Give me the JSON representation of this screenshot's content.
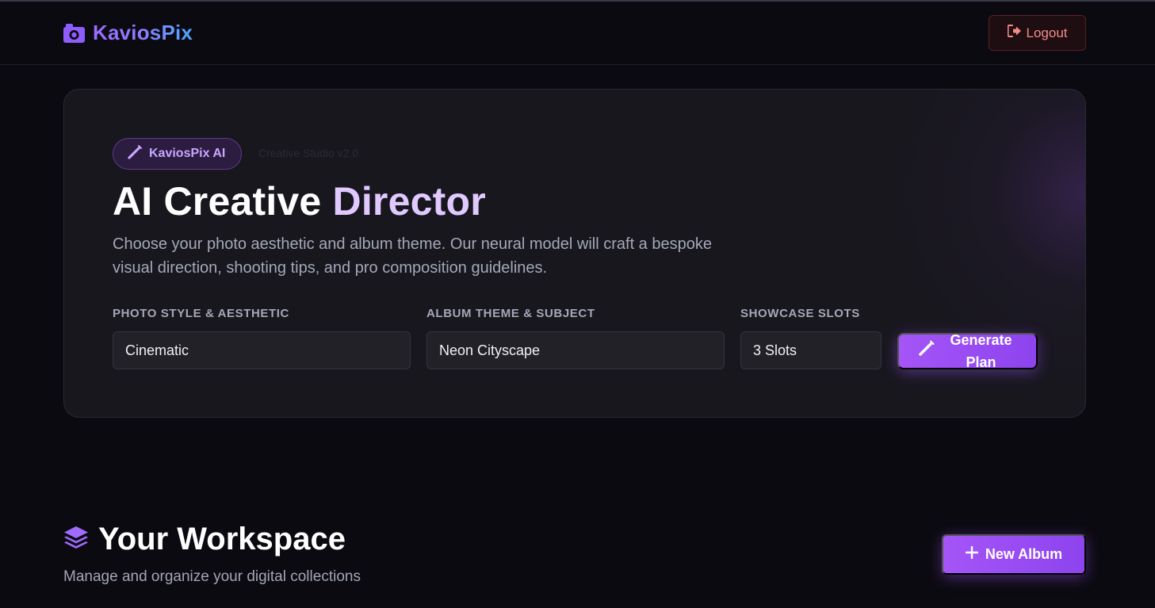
{
  "header": {
    "brand_name": "KaviosPix",
    "brand_icon": "camera-icon",
    "logout_label": "Logout",
    "logout_icon": "sign-out-icon"
  },
  "hero": {
    "badge_label": "KaviosPix AI",
    "badge_icon": "magic-wand-icon",
    "version": "Creative Studio v2.0",
    "title_main": "AI Creative",
    "title_accent": "Director",
    "description": "Choose your photo aesthetic and album theme. Our neural model will craft a bespoke visual direction, shooting tips, and pro composition guidelines.",
    "fields": {
      "style": {
        "label": "PHOTO STYLE & AESTHETIC",
        "value": "Cinematic"
      },
      "theme": {
        "label": "ALBUM THEME & SUBJECT",
        "value": "Neon Cityscape"
      },
      "slots": {
        "label": "SHOWCASE SLOTS",
        "value": "3 Slots"
      }
    },
    "generate_label": "Generate Plan",
    "generate_icon": "magic-wand-icon"
  },
  "workspace": {
    "title": "Your Workspace",
    "title_icon": "layers-icon",
    "subtitle": "Manage and organize your digital collections",
    "new_album_label": "New Album",
    "new_album_icon": "plus-icon"
  },
  "colors": {
    "background": "#0b0a10",
    "card": "#18171e",
    "accent": "#a555f7",
    "accent_light": "#e0c9ff",
    "danger": "#f28b8b"
  }
}
